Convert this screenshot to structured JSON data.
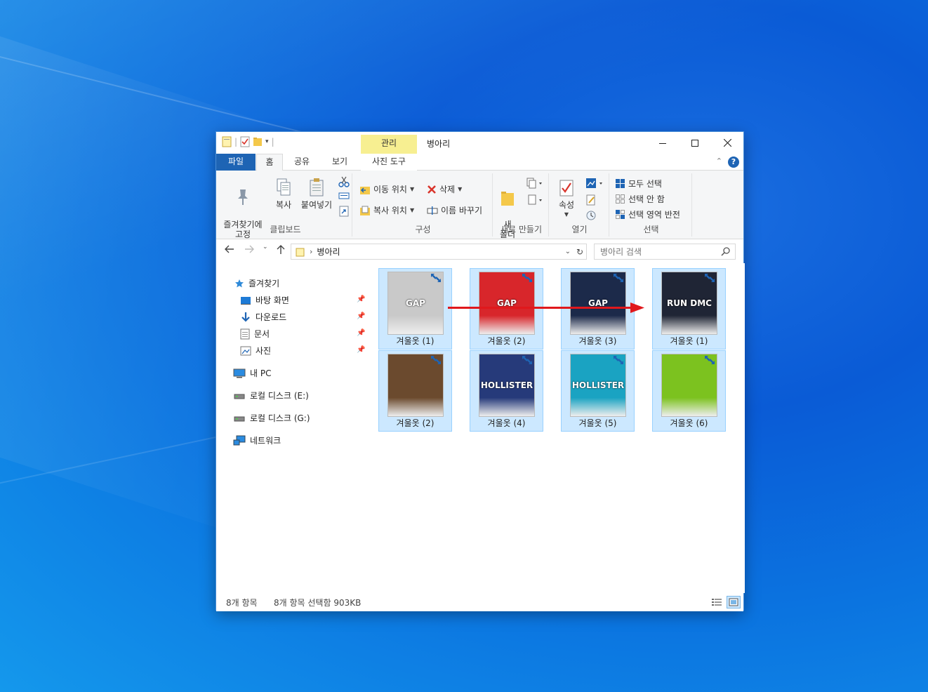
{
  "window": {
    "title": "병아리",
    "context_tab": "관리"
  },
  "ribbon_tabs": {
    "file": "파일",
    "home": "홈",
    "share": "공유",
    "view": "보기",
    "photo_tools": "사진 도구"
  },
  "ribbon": {
    "clipboard": {
      "pin": "즐겨찾기에\n고정",
      "copy": "복사",
      "paste": "붙여넣기",
      "label": "클립보드"
    },
    "organize": {
      "move_to": "이동 위치",
      "copy_to": "복사 위치",
      "delete": "삭제",
      "rename": "이름 바꾸기",
      "label": "구성"
    },
    "new": {
      "new_folder": "새\n폴더",
      "label": "새로 만들기"
    },
    "open": {
      "properties": "속성",
      "label": "열기"
    },
    "select": {
      "select_all": "모두 선택",
      "select_none": "선택 안 함",
      "invert": "선택 영역 반전",
      "label": "선택"
    }
  },
  "address": {
    "path": "병아리",
    "search_placeholder": "병아리 검색"
  },
  "sidebar": {
    "favorites": "즐겨찾기",
    "items": [
      "바탕 화면",
      "다운로드",
      "문서",
      "사진"
    ],
    "my_pc": "내 PC",
    "drive_e": "로컬 디스크 (E:)",
    "drive_g": "로컬 디스크 (G:)",
    "network": "네트워크"
  },
  "files": [
    {
      "name": "겨울옷 (1)",
      "color": "#c9c9c9",
      "text": "GAP"
    },
    {
      "name": "겨울옷 (2)",
      "color": "#d8262b",
      "text": "GAP"
    },
    {
      "name": "겨울옷 (3)",
      "color": "#1c2a4a",
      "text": "GAP"
    },
    {
      "name": "겨울옷 (1)",
      "color": "#1f2535",
      "text": "RUN DMC"
    },
    {
      "name": "겨울옷 (2)",
      "color": "#6b4a2e",
      "text": ""
    },
    {
      "name": "겨울옷 (4)",
      "color": "#263a7a",
      "text": "HOLLISTER"
    },
    {
      "name": "겨울옷 (5)",
      "color": "#1aa3c2",
      "text": "HOLLISTER"
    },
    {
      "name": "겨울옷 (6)",
      "color": "#7cc21f",
      "text": ""
    }
  ],
  "status": {
    "count": "8개 항목",
    "selection": "8개 항목 선택함 903KB"
  },
  "colors": {
    "selection_bg": "#cce8ff",
    "file_tab": "#1e64b4",
    "context_tab": "#f7ef91",
    "arrow": "#e0181c"
  }
}
